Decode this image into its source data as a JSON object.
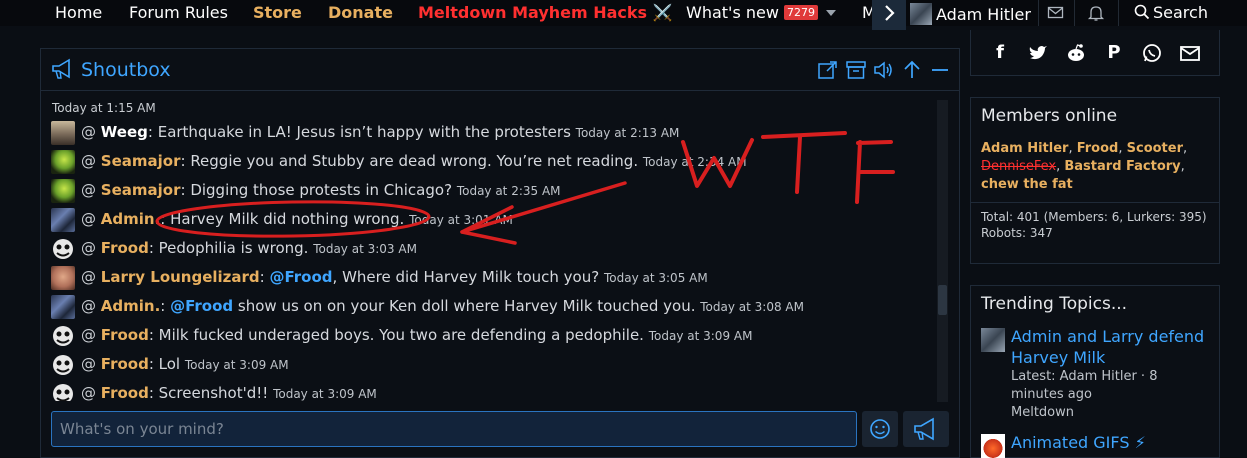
{
  "nav": {
    "home": "Home",
    "forum_rules": "Forum Rules",
    "store": "Store",
    "donate": "Donate",
    "hacks": "Meltdown Mayhem Hacks",
    "hacks_emoji": "⚔️",
    "whats_new": "What's new",
    "whats_new_count": "7279",
    "more_truncated": "M",
    "user": "Adam Hitler",
    "search": "Search"
  },
  "shoutbox": {
    "title": "Shoutbox",
    "date_header": "Today at 1:15 AM",
    "messages": [
      {
        "user": "Weeg",
        "sep": ": ",
        "text": "Earthquake in LA! Jesus isn’t happy with the protesters",
        "time": "Today at 2:13 AM",
        "avatar_color": "#7a6a5a"
      },
      {
        "user": "Seamajor",
        "sep": ": ",
        "text": "Reggie you and Stubby are dead wrong. You’re net reading.",
        "time": "Today at 2:34 AM",
        "avatar_color": "#8ab83a"
      },
      {
        "user": "Seamajor",
        "sep": ": ",
        "text": "Digging those protests in Chicago?",
        "time": "Today at 2:35 AM",
        "avatar_color": "#8ab83a"
      },
      {
        "user": "Admin.",
        "sep": ": ",
        "text": "Harvey Milk did nothing wrong.",
        "time": "Today at 3:01 AM",
        "avatar_color": "#4a5a7a"
      },
      {
        "user": "Frood",
        "sep": ": ",
        "text": "Pedophilia is wrong.",
        "time": "Today at 3:03 AM",
        "avatar_color": "#d8d8d8"
      },
      {
        "user": "Larry Loungelizard",
        "sep": ": ",
        "mention": "@Frood",
        "text": ", Where did Harvey Milk touch you?",
        "time": "Today at 3:05 AM",
        "avatar_color": "#c08060"
      },
      {
        "user": "Admin.",
        "sep": ": ",
        "mention": "@Frood",
        "text": " show us on on your Ken doll where Harvey Milk touched you.",
        "time": "Today at 3:08 AM",
        "avatar_color": "#4a5a7a"
      },
      {
        "user": "Frood",
        "sep": ": ",
        "text": "Milk fucked underaged boys. You two are defending a pedophile.",
        "time": "Today at 3:09 AM",
        "avatar_color": "#d8d8d8"
      },
      {
        "user": "Frood",
        "sep": ": ",
        "text": "Lol",
        "time": "Today at 3:09 AM",
        "avatar_color": "#d8d8d8"
      },
      {
        "user": "Frood",
        "sep": ": ",
        "text": "Screenshot'd!!",
        "time": "Today at 3:09 AM",
        "avatar_color": "#d8d8d8"
      }
    ],
    "input_placeholder": "What's on your mind?"
  },
  "annotation": {
    "text": "WTF",
    "color": "#d81f1f"
  },
  "members_online": {
    "title": "Members online",
    "members": [
      "Adam Hitler",
      "Frood",
      "Scooter",
      "DenniseFex",
      "Bastard Factory",
      "chew the fat"
    ],
    "banned_member": "DenniseFex",
    "total_line": "Total: 401 (Members: 6, Lurkers: 395)",
    "robots_line": "Robots: 347"
  },
  "trending": {
    "title": "Trending Topics...",
    "items": [
      {
        "title": "Admin and Larry defend Harvey Milk",
        "latest": "Latest: Adam Hitler · 8 minutes ago",
        "forum": "Meltdown"
      },
      {
        "title": "Animated GIFS ⚡",
        "latest": "",
        "forum": ""
      }
    ]
  },
  "colors": {
    "accent": "#3fa6ff",
    "username": "#e8b060",
    "danger": "#ff3030",
    "background": "#0a0e14"
  }
}
